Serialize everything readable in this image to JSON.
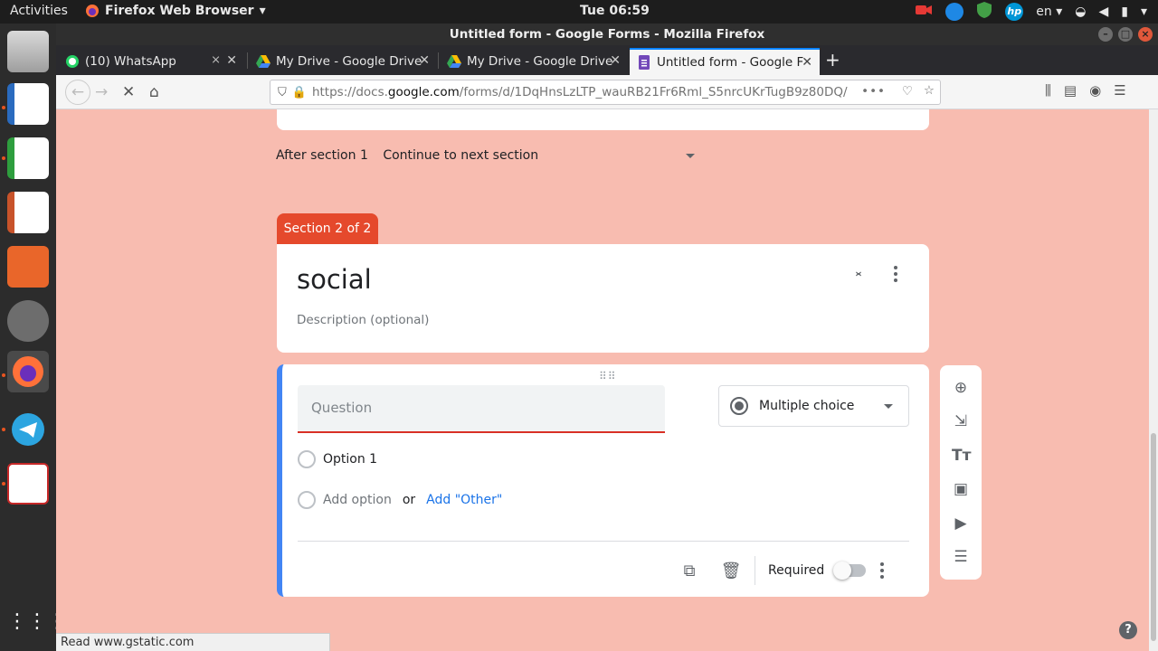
{
  "topbar": {
    "activities": "Activities",
    "app_name": "Firefox Web Browser",
    "clock": "Tue 06:59",
    "language": "en"
  },
  "window": {
    "title": "Untitled form - Google Forms - Mozilla Firefox"
  },
  "tabs": [
    {
      "label": "(10) WhatsApp",
      "icon": "whatsapp-icon",
      "muted": true
    },
    {
      "label": "My Drive - Google Drive",
      "icon": "google-drive-icon"
    },
    {
      "label": "My Drive - Google Drive",
      "icon": "google-drive-icon"
    },
    {
      "label": "Untitled form - Google F",
      "icon": "google-forms-icon",
      "active": true
    }
  ],
  "url": {
    "prefix": "https://docs.",
    "host": "google.com",
    "path": "/forms/d/1DqHnsLzLTP_wauRB21Fr6Rml_S5nrcUKrTugB9z80DQ/"
  },
  "form": {
    "after_section_label": "After section 1",
    "after_section_value": "Continue to next section",
    "section_tab": "Section 2 of 2",
    "section_title": "social",
    "section_description_placeholder": "Description (optional)",
    "question": {
      "placeholder": "Question",
      "type": "Multiple choice",
      "option_1": "Option 1",
      "add_option": "Add option",
      "or": "or",
      "add_other": "Add \"Other\"",
      "required_label": "Required",
      "required": false
    }
  },
  "status_text": "Read www.gstatic.com",
  "colors": {
    "page_background": "#f8bcb0",
    "section_tab": "#e5492c",
    "question_accent": "#4285f4",
    "question_underline": "#d93025",
    "link": "#1a73e8"
  }
}
